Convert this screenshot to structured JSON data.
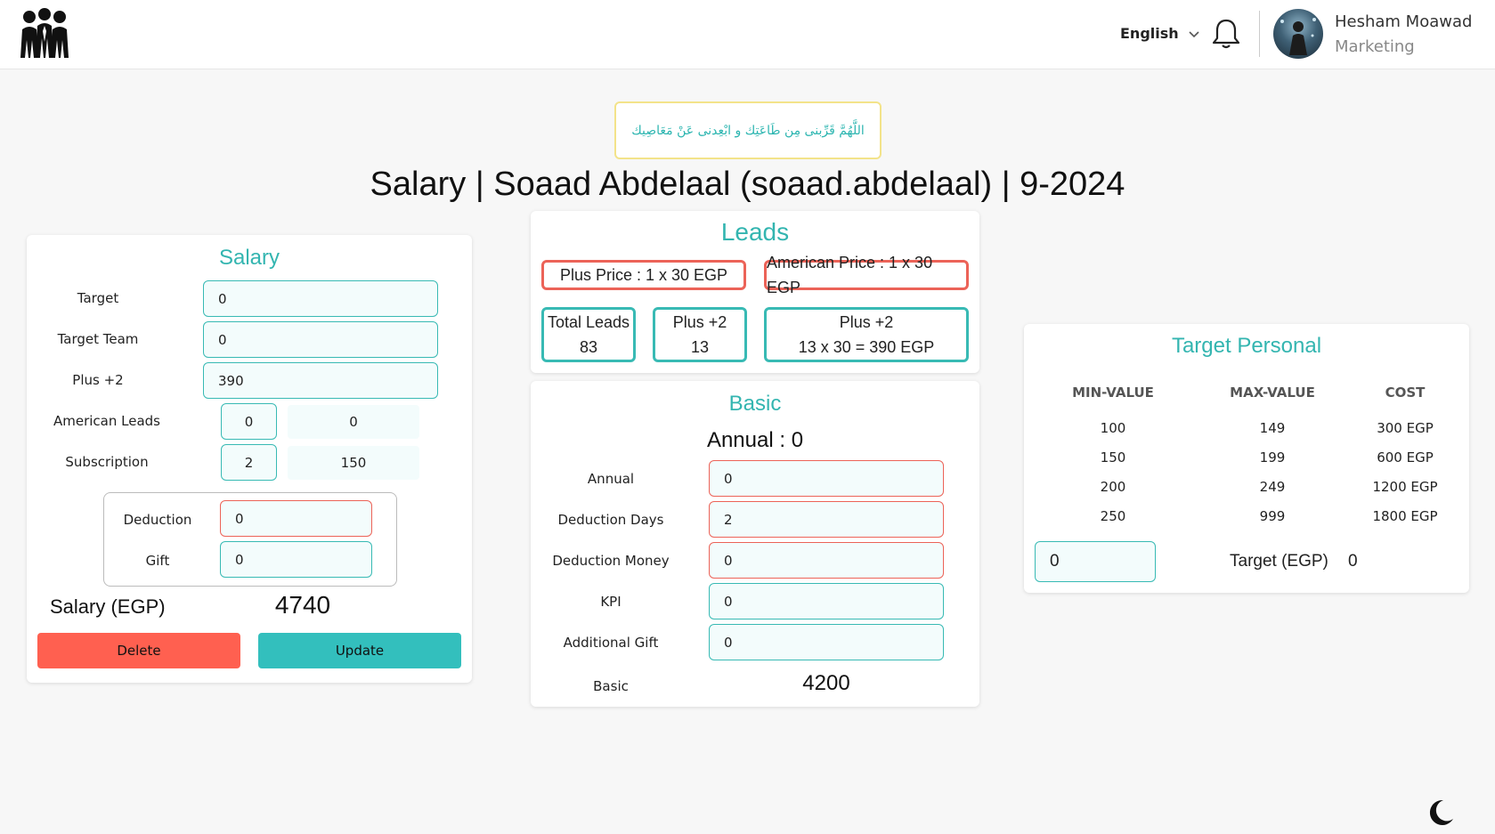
{
  "header": {
    "language": "English",
    "user_name": "Hesham Moawad",
    "user_role": "Marketing"
  },
  "quote": "اللَّهُمَّ قَرِّبنى مِن طَاعَتِك و ابْعِدنى عَنْ مَعَاصِيك",
  "page_title": "Salary | Soaad Abdelaal (soaad.abdelaal) | 9-2024",
  "salary_card": {
    "title": "Salary",
    "fields": [
      {
        "label": "Target",
        "value": "0"
      },
      {
        "label": "Target Team",
        "value": "0"
      },
      {
        "label": "Plus +2",
        "value": "390"
      }
    ],
    "american_leads": {
      "label": "American Leads",
      "input": "0",
      "computed": "0"
    },
    "subscription": {
      "label": "Subscription",
      "input": "2",
      "computed": "150"
    },
    "deduction": {
      "label": "Deduction",
      "value": "0"
    },
    "gift": {
      "label": "Gift",
      "value": "0"
    },
    "salary_label": "Salary (EGP)",
    "salary_value": "4740",
    "delete_label": "Delete",
    "update_label": "Update"
  },
  "leads_card": {
    "title": "Leads",
    "plus_price": "Plus Price : 1 x 30 EGP",
    "american_price": "American Price : 1 x 30 EGP",
    "total_leads_label": "Total Leads",
    "total_leads_value": "83",
    "plus2_label": "Plus +2",
    "plus2_value": "13",
    "plus2_calc_label": "Plus +2",
    "plus2_calc_value": "13 x 30 = 390 EGP"
  },
  "basic_card": {
    "title": "Basic",
    "annual_summary": "Annual : 0",
    "fields": [
      {
        "label": "Annual",
        "value": "0"
      },
      {
        "label": "Deduction Days",
        "value": "2"
      },
      {
        "label": "Deduction Money",
        "value": "0"
      },
      {
        "label": "KPI",
        "value": "0"
      },
      {
        "label": "Additional Gift",
        "value": "0"
      }
    ],
    "basic_label": "Basic",
    "basic_value": "4200"
  },
  "target_card": {
    "title": "Target Personal",
    "columns": [
      "MIN-VALUE",
      "MAX-VALUE",
      "COST"
    ],
    "rows": [
      [
        "100",
        "149",
        "300 EGP"
      ],
      [
        "150",
        "199",
        "600 EGP"
      ],
      [
        "200",
        "249",
        "1200 EGP"
      ],
      [
        "250",
        "999",
        "1800 EGP"
      ]
    ],
    "input_value": "0",
    "target_label": "Target (EGP)",
    "target_value": "0"
  },
  "colors": {
    "teal": "#38bab4",
    "red": "#ec6358",
    "delete_btn": "#ff6050",
    "update_btn": "#33bfbd",
    "quote_border": "#f3e38a"
  }
}
